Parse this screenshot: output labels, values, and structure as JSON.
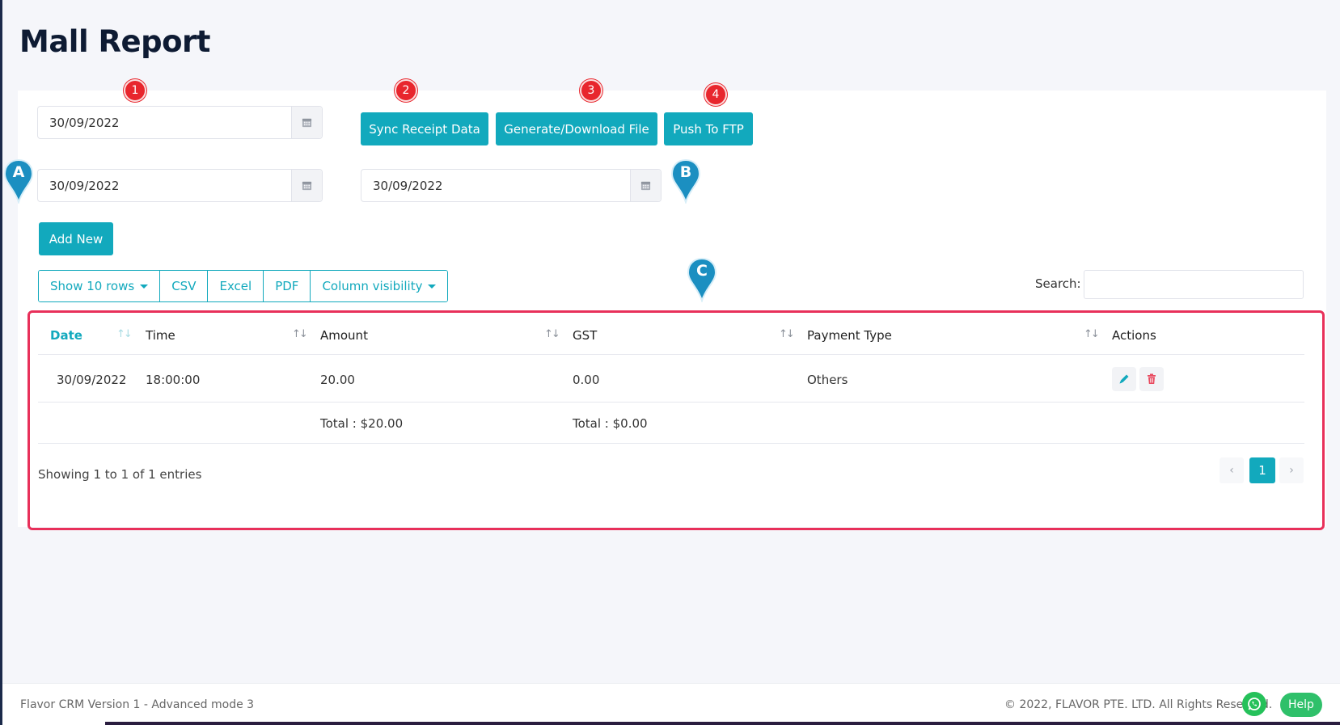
{
  "page": {
    "title": "Mall Report"
  },
  "filters": {
    "report_date": "30/09/2022",
    "start_date": "30/09/2022",
    "end_date": "30/09/2022"
  },
  "actions": {
    "sync_label": "Sync Receipt Data",
    "generate_label": "Generate/Download File",
    "push_label": "Push To FTP",
    "add_new_label": "Add New"
  },
  "markers": {
    "red": [
      "1",
      "2",
      "3",
      "4"
    ],
    "blue": [
      "A",
      "B",
      "C"
    ]
  },
  "toolbar": {
    "show_rows": "Show 10 rows",
    "csv": "CSV",
    "excel": "Excel",
    "pdf": "PDF",
    "column_visibility": "Column visibility",
    "search_label": "Search:",
    "search_value": ""
  },
  "table": {
    "headers": [
      "Date",
      "Time",
      "Amount",
      "GST",
      "Payment Type",
      "Actions"
    ],
    "rows": [
      {
        "date": "30/09/2022",
        "time": "18:00:00",
        "amount": "20.00",
        "gst": "0.00",
        "payment_type": "Others"
      }
    ],
    "totals": {
      "amount": "Total : $20.00",
      "gst": "Total : $0.00"
    }
  },
  "pagination": {
    "info": "Showing 1 to 1 of 1 entries",
    "prev": "‹",
    "current": "1",
    "next": "›"
  },
  "footer": {
    "left": "Flavor CRM Version 1 - Advanced mode 3",
    "right": "© 2022, FLAVOR PTE. LTD. All Rights Reserved.",
    "help": "Help"
  },
  "colors": {
    "accent": "#12a9bd",
    "marker_red": "#e8262d",
    "highlight": "#e8305a",
    "whatsapp": "#25c15a"
  }
}
